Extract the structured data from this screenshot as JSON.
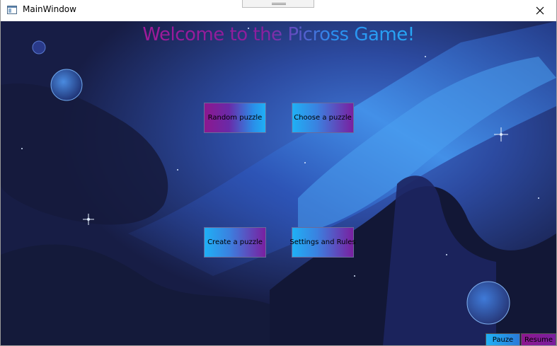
{
  "window": {
    "title": "MainWindow"
  },
  "headline": "Welcome to the Picross Game!",
  "menu": {
    "random_label": "Random puzzle",
    "choose_label": "Choose a puzzle",
    "create_label": "Create a puzzle",
    "settings_label": "Settings and Rules"
  },
  "footer": {
    "pause_label": "Pauze",
    "resume_label": "Resume"
  },
  "colors": {
    "purple": "#8d178f",
    "blue": "#1fb0f5",
    "night": "#1a2150"
  }
}
